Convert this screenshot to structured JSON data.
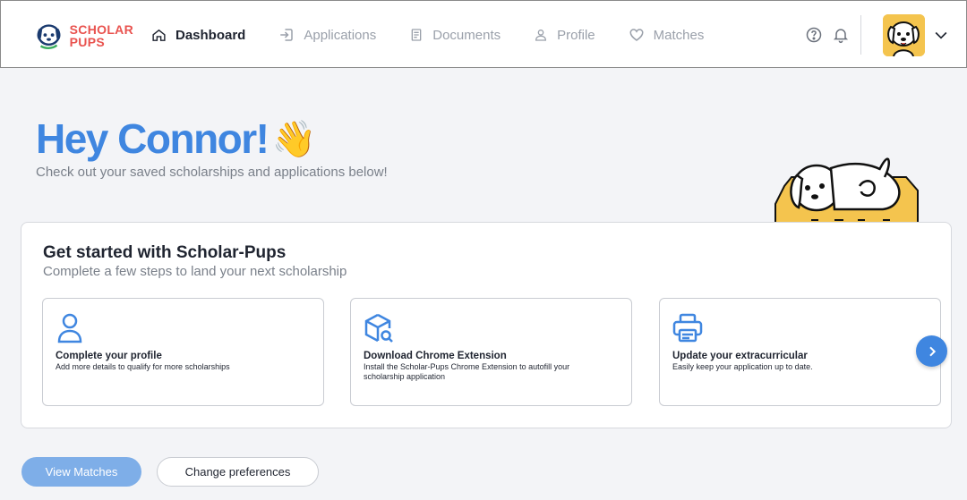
{
  "brand": {
    "line1": "SCHOLAR",
    "line2": "PUPS",
    "accent_color": "#e9534f",
    "primary_color": "#3f86e0"
  },
  "nav": {
    "items": [
      {
        "label": "Dashboard",
        "icon": "home-icon",
        "active": true
      },
      {
        "label": "Applications",
        "icon": "sign-in-icon",
        "active": false
      },
      {
        "label": "Documents",
        "icon": "document-icon",
        "active": false
      },
      {
        "label": "Profile",
        "icon": "user-icon",
        "active": false
      },
      {
        "label": "Matches",
        "icon": "heart-icon",
        "active": false
      }
    ]
  },
  "header_icons": [
    "help-icon",
    "bell-icon",
    "chevron-down-icon"
  ],
  "greeting": {
    "title": "Hey Connor!",
    "emoji": "👋",
    "subtitle": "Check out your saved scholarships and applications below!"
  },
  "get_started": {
    "title": "Get started with Scholar-Pups",
    "subtitle": "Complete a few steps to land your next scholarship",
    "steps": [
      {
        "icon": "user-icon",
        "title": "Complete your profile",
        "description": "Add more details to qualify for more scholarships"
      },
      {
        "icon": "box-search-icon",
        "title": "Download Chrome Extension",
        "description": "Install the Scholar-Pups Chrome Extension to autofill your scholarship application"
      },
      {
        "icon": "printer-icon",
        "title": "Update your extracurricular",
        "description": "Easily keep your application up to date."
      }
    ],
    "next_icon": "chevron-right-icon"
  },
  "actions": {
    "primary": "View Matches",
    "secondary": "Change preferences"
  }
}
